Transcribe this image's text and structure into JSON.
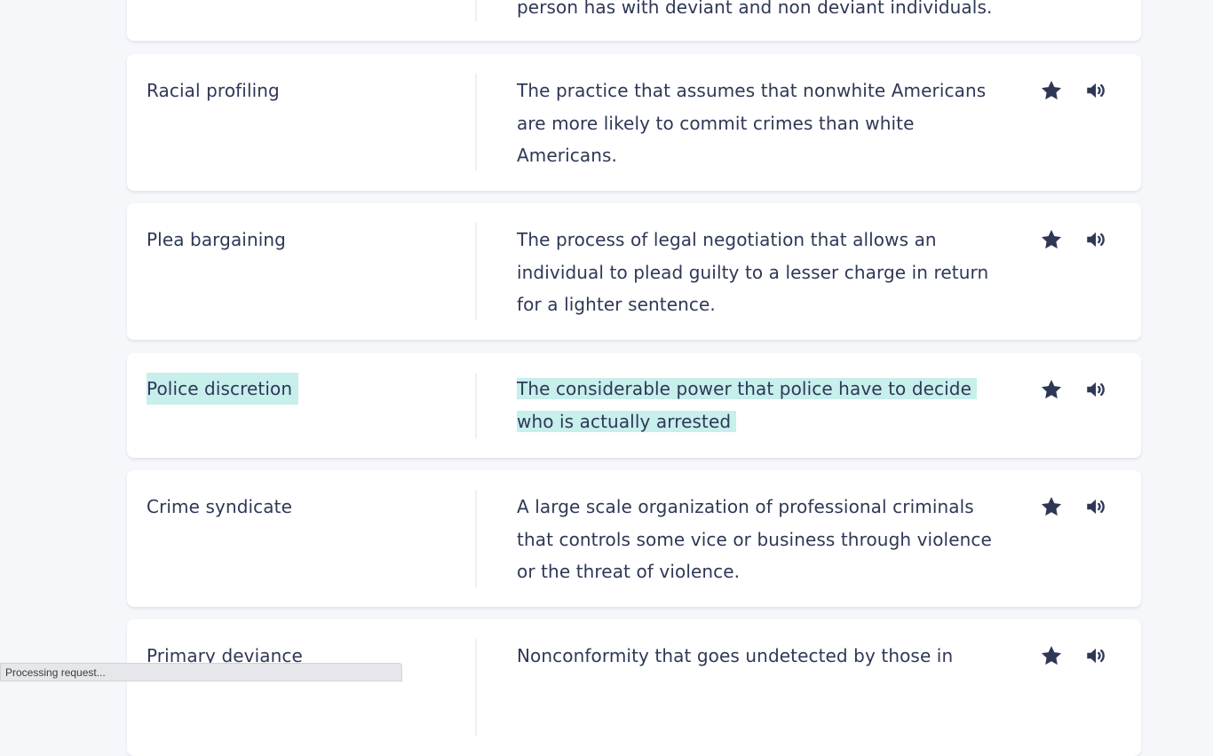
{
  "cards": [
    {
      "term": "",
      "definition": "person has with deviant and non deviant individuals."
    },
    {
      "term": "Racial profiling",
      "definition": "The practice that assumes that nonwhite Americans are more likely to commit crimes than white Americans."
    },
    {
      "term": "Plea bargaining",
      "definition": "The process of legal negotiation that allows an individual to plead guilty to a lesser charge in return for a lighter sentence."
    },
    {
      "term": "Police discretion",
      "definition": "The considerable power that police have to decide who is actually arrested"
    },
    {
      "term": "Crime syndicate",
      "definition": "A large scale organization of professional criminals that controls some vice or business through violence or the threat of violence."
    },
    {
      "term": "Primary deviance",
      "definition": "Nonconformity that goes undetected by those in"
    }
  ],
  "highlighted_card": 3,
  "icons": {
    "star": "star-icon",
    "audio": "speaker-icon"
  },
  "status": {
    "text": "Processing request..."
  },
  "colors": {
    "background": "#f6f7fb",
    "text": "#2e3856",
    "highlight": "#c7efec",
    "card": "#ffffff"
  }
}
